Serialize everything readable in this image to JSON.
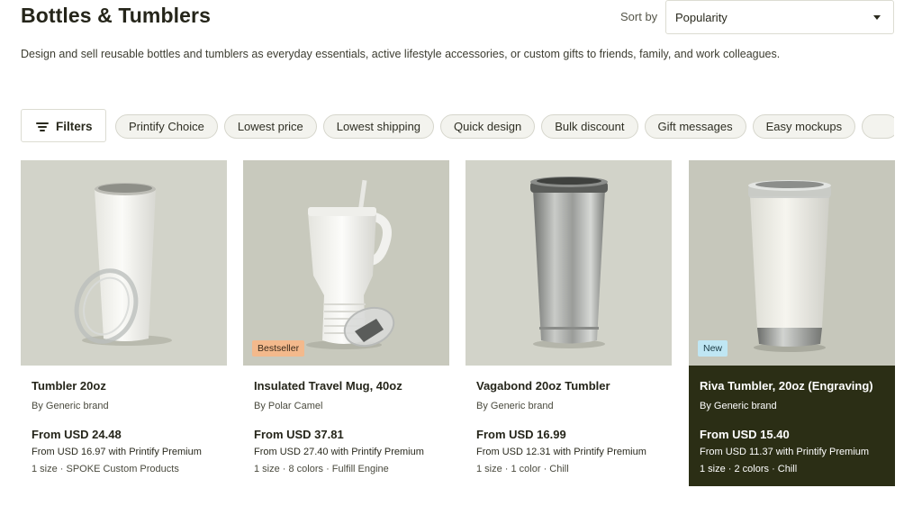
{
  "header": {
    "title": "Bottles & Tumblers",
    "sort_label": "Sort by",
    "sort_value": "Popularity",
    "description": "Design and sell reusable bottles and tumblers as everyday essentials, active lifestyle accessories, or custom gifts to friends, family, and work colleagues."
  },
  "filters": {
    "label": "Filters",
    "icon": "filter-lines-icon",
    "chips": [
      "Printify Choice",
      "Lowest price",
      "Lowest shipping",
      "Quick design",
      "Bulk discount",
      "Gift messages",
      "Easy mockups",
      ""
    ]
  },
  "colors": {
    "card_highlight_bg": "#2b2e15",
    "bestseller_badge": "#f3b98c",
    "new_badge": "#bfe6f3"
  },
  "products": [
    {
      "name": "Tumbler 20oz",
      "brand": "By Generic brand",
      "price": "From USD 24.48",
      "premium": "From USD 16.97 with Printify Premium",
      "meta": "1 size · SPOKE Custom Products",
      "badge": "",
      "image_bg": "#d2d3c9"
    },
    {
      "name": "Insulated Travel Mug, 40oz",
      "brand": "By Polar Camel",
      "price": "From USD 37.81",
      "premium": "From USD 27.40 with Printify Premium",
      "meta": "1 size · 8 colors · Fulfill Engine",
      "badge": "Bestseller",
      "image_bg": "#c8c9bd"
    },
    {
      "name": "Vagabond 20oz Tumbler",
      "brand": "By Generic brand",
      "price": "From USD 16.99",
      "premium": "From USD 12.31 with Printify Premium",
      "meta": "1 size · 1 color · Chill",
      "badge": "",
      "image_bg": "#d2d3c9"
    },
    {
      "name": "Riva Tumbler, 20oz (Engraving)",
      "brand": "By Generic brand",
      "price": "From USD 15.40",
      "premium": "From USD 11.37 with Printify Premium",
      "meta": "1 size · 2 colors · Chill",
      "badge": "New",
      "image_bg": "#c6c7bb"
    }
  ]
}
